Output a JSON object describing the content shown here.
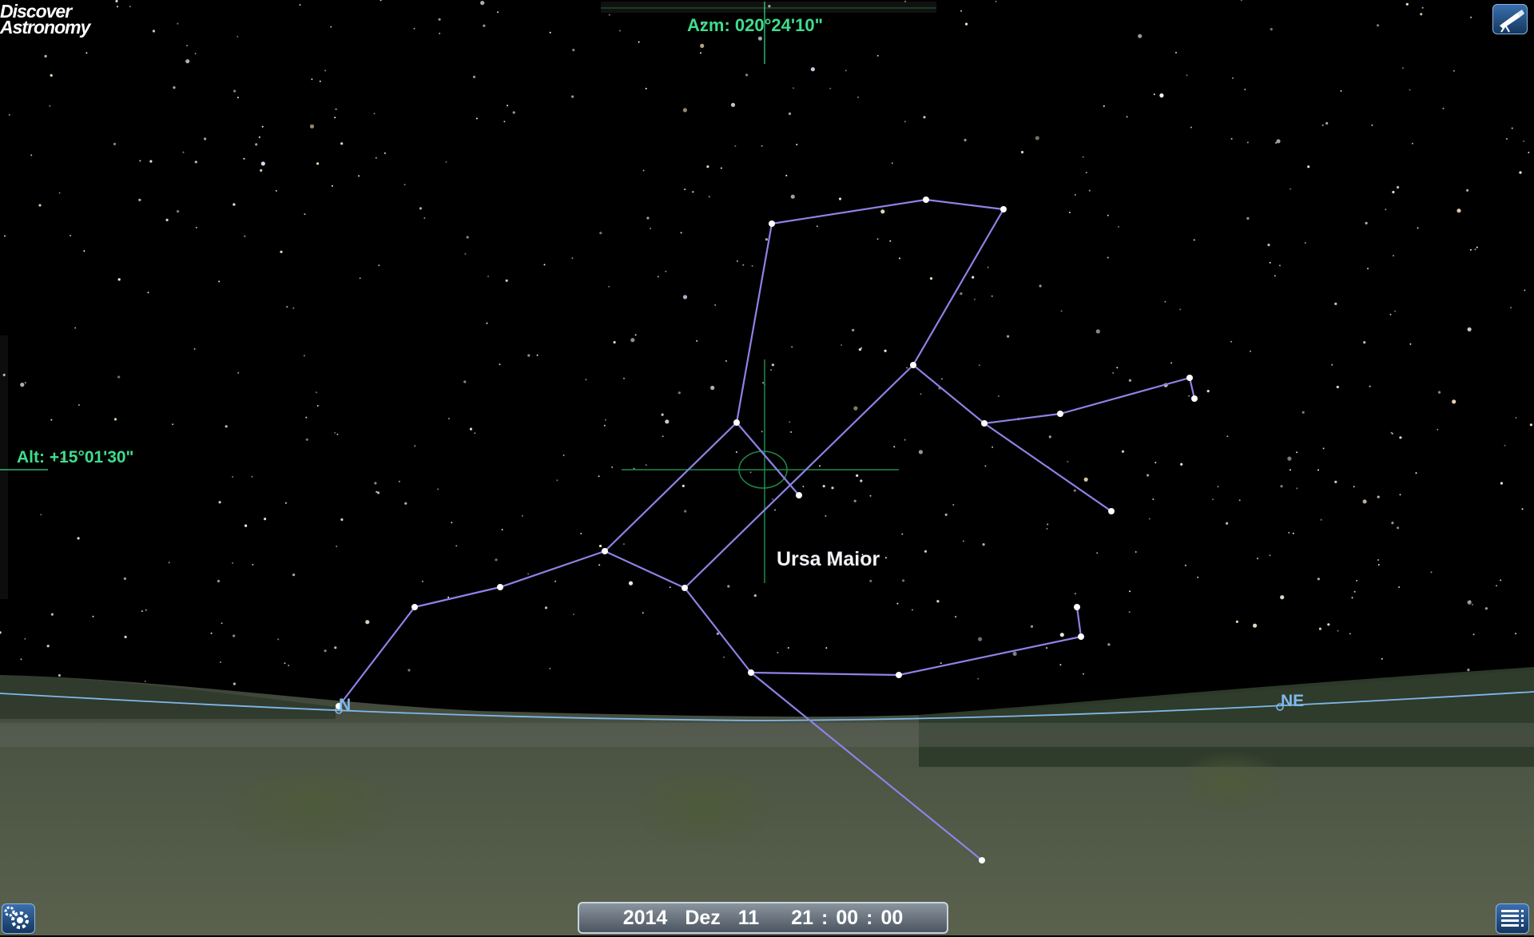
{
  "app": {
    "logo_line1": "Discover",
    "logo_line2": "Astronomy"
  },
  "readouts": {
    "azimuth": "Azm: 020°24'10\"",
    "altitude": "Alt: +15°01'30\""
  },
  "constellation": {
    "label": "Ursa Maior",
    "line_color": "#8d83e6"
  },
  "compass": {
    "north": "N",
    "northeast": "NE",
    "horizon_color": "#7fb8ea"
  },
  "datetime": {
    "year": "2014",
    "month": "Dez",
    "day": "11",
    "hour": "21",
    "minute": "00",
    "second": "00",
    "separator": ":"
  },
  "colors": {
    "readout": "#3fdc8c",
    "sky": "#000000"
  },
  "icons": {
    "telescope": "telescope-icon",
    "settings": "gear-icon",
    "list": "list-icon"
  }
}
